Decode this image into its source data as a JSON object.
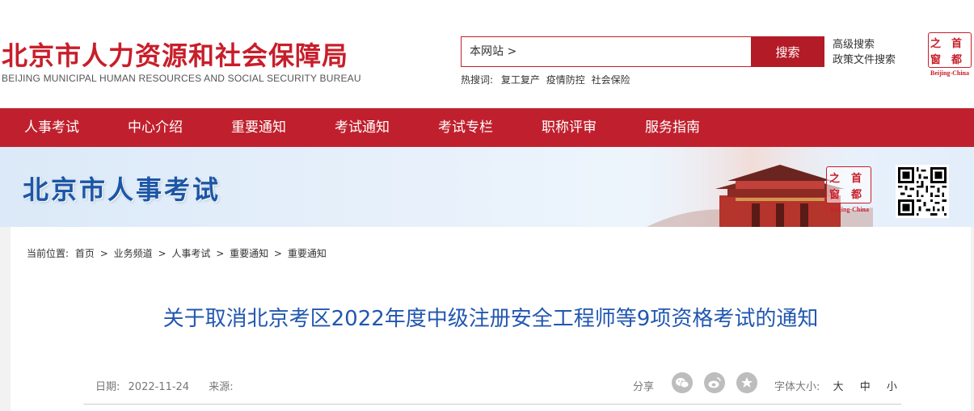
{
  "header": {
    "title": "北京市人力资源和社会保障局",
    "subtitle": "BEIJING MUNICIPAL HUMAN RESOURCES AND SOCIAL SECURITY BUREAU",
    "search_scope": "本网站 >",
    "search_button": "搜索",
    "hot_label": "热搜词:",
    "hot_keywords": [
      "复工复产",
      "疫情防控",
      "社会保险"
    ],
    "advanced_search": "高级搜索",
    "policy_search": "政策文件搜索",
    "logo_chars": [
      "之",
      "首",
      "窗",
      "都"
    ],
    "logo_caption": "Beijing-China"
  },
  "nav": {
    "items": [
      "人事考试",
      "中心介绍",
      "重要通知",
      "考试通知",
      "考试专栏",
      "职称评审",
      "服务指南"
    ]
  },
  "banner": {
    "title": "北京市人事考试",
    "logo_chars": [
      "之",
      "首",
      "窗",
      "都"
    ],
    "logo_caption": "Beijing-China"
  },
  "breadcrumb": {
    "label": "当前位置:",
    "items": [
      "首页",
      "业务频道",
      "人事考试",
      "重要通知",
      "重要通知"
    ],
    "separator": ">"
  },
  "article": {
    "title": "关于取消北京考区2022年度中级注册安全工程师等9项资格考试的通知",
    "date_label": "日期:",
    "date": "2022-11-24",
    "source_label": "来源:",
    "source": "",
    "share_label": "分享",
    "share_icons": [
      "wechat-icon",
      "weibo-icon",
      "favorite-icon"
    ],
    "font_size_label": "字体大小:",
    "font_sizes": [
      "大",
      "中",
      "小"
    ]
  },
  "colors": {
    "brand_red": "#c0202d",
    "title_blue": "#2157b0",
    "banner_blue": "#1c56a6"
  }
}
